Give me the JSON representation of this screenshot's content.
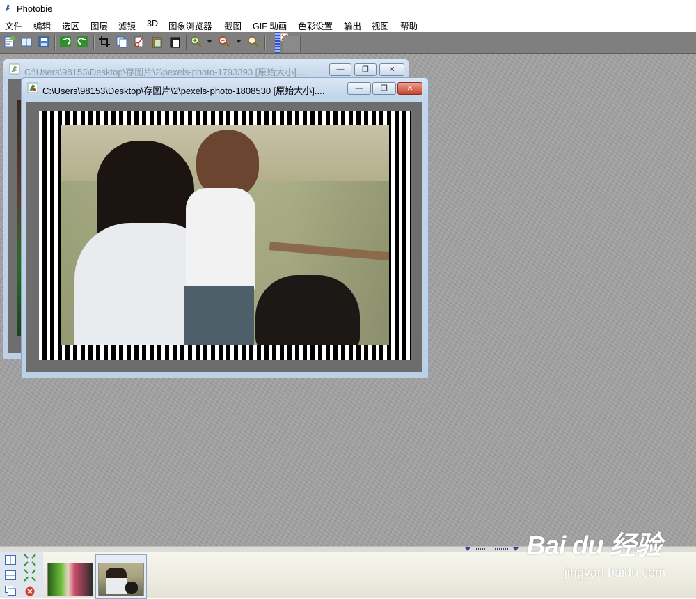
{
  "app": {
    "title": "Photobie"
  },
  "menu": [
    "文件",
    "编辑",
    "选区",
    "图层",
    "滤镜",
    "3D",
    "图象浏览器",
    "截图",
    "GIF 动画",
    "色彩设置",
    "输出",
    "视图",
    "帮助"
  ],
  "toolbar": {
    "icons": [
      "new-file-icon",
      "open-file-icon",
      "save-icon",
      "undo-icon",
      "redo-icon",
      "crop-icon",
      "copy-icon",
      "cut-icon",
      "paste-icon",
      "paste-new-icon",
      "zoom-in-icon",
      "zoom-out-icon",
      "zoom-icon"
    ]
  },
  "windows": {
    "back": {
      "title": "C:\\Users\\98153\\Desktop\\存图片\\2\\pexels-photo-1793393 [原始大小]...."
    },
    "front": {
      "title": "C:\\Users\\98153\\Desktop\\存图片\\2\\pexels-photo-1808530 [原始大小]...."
    }
  },
  "window_buttons": {
    "minimize": "—",
    "restore": "❐",
    "close": "✕"
  },
  "bottom_bar": {
    "thumbnails": [
      "pexels-photo-1793393",
      "pexels-photo-1808530"
    ],
    "selected_index": 1
  },
  "watermark": {
    "logo": "Bai du 经验",
    "url": "jingyan.baidu.com"
  },
  "colors": {
    "workspace": "#a3a3a3",
    "toolbar": "#7f7f7f",
    "titlebar_active_close": "#c5442e"
  }
}
